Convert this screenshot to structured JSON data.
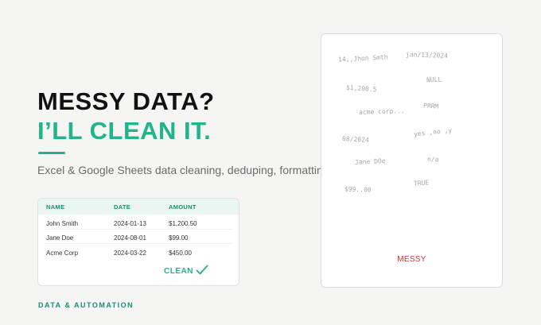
{
  "colors": {
    "accent": "#1fb48a",
    "accent_dark": "#1a8f6d",
    "messy_red": "#d32f2f",
    "background": "#f5f5f3"
  },
  "hero": {
    "headline_line1": "MESSY DATA?",
    "headline_line2": "I’LL CLEAN IT.",
    "subtitle": "Excel & Google Sheets data cleaning, deduping, formatting"
  },
  "clean_table": {
    "headers": [
      "NAME",
      "DATE",
      "AMOUNT"
    ],
    "rows": [
      [
        "John Smith",
        "2024-01-13",
        "$1,200.50"
      ],
      [
        "Jane Doe",
        "2024-08-01",
        "$99.00"
      ],
      [
        "Acme Corp",
        "2024-03-22",
        "$450.00"
      ]
    ],
    "badge_label": "CLEAN",
    "badge_icon": "checkmark-icon"
  },
  "messy_card": {
    "items": [
      "14,,Jhon Smth",
      "jan/13/2024",
      "NULL",
      "$1,200.5",
      "PRRM",
      "acme corp...",
      "yes ,no ,y",
      "08/2024",
      "Jane DOe",
      "n/a",
      "TRUE",
      "$99..00"
    ],
    "label": "MESSY"
  },
  "footer": {
    "tag": "DATA & AUTOMATION"
  }
}
